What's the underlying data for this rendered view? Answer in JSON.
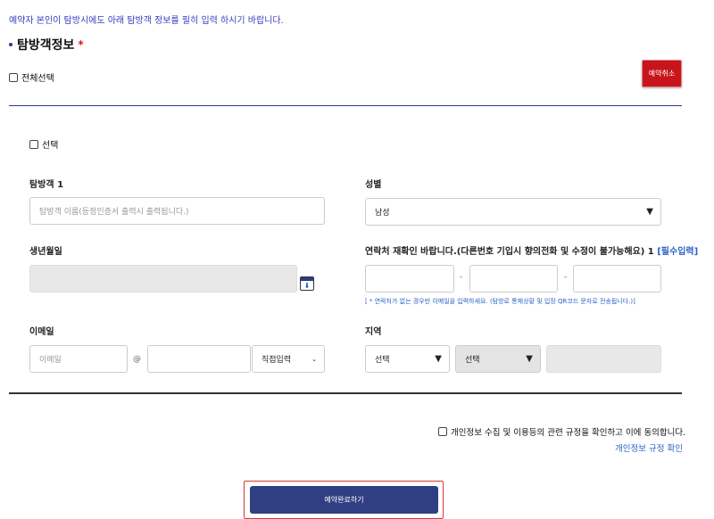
{
  "notice": "예약자 본인이 탐방시에도 아래 탐방객 정보를 필히 입력 하시기 바랍니다.",
  "section": {
    "title": "탐방객정보",
    "required_mark": "*"
  },
  "select_all": "전체선택",
  "cancel_button": "예약취소",
  "visitor": {
    "select_label": "선택",
    "name_label": "탐방객 1",
    "name_placeholder": "탐방객 이름(등정인증서 출력시 출력됩니다.)",
    "gender_label": "성별",
    "gender_value": "남성",
    "birth_label": "생년월일",
    "phone_label": "연락처 재확인 바랍니다.(다른번호 기입시 향의전화 및 수정이 불가능해요) 1",
    "phone_required": "[필수입력]",
    "phone_sep": "-",
    "phone_hint": "[ * 연락처가 없는 경우만 이메일을 입력하세요. (탐방로 통제상황 및 입장 QR코드 문자로 전송됩니다.)]",
    "email_label": "이메일",
    "email_placeholder": "이메일",
    "email_at": "@",
    "email_domain_option": "직접입력",
    "region_label": "지역",
    "region_select1": "선택",
    "region_select2": "선택"
  },
  "agree": {
    "text": "개인정보 수집 및 이용등의 관련 규정을 확인하고 이에 동의합니다.",
    "link": "개인정보 규정 확인"
  },
  "submit_button": "예약완료하기",
  "icons": {
    "calendar": "calendar-icon",
    "arrow": "chevron-down-icon"
  }
}
